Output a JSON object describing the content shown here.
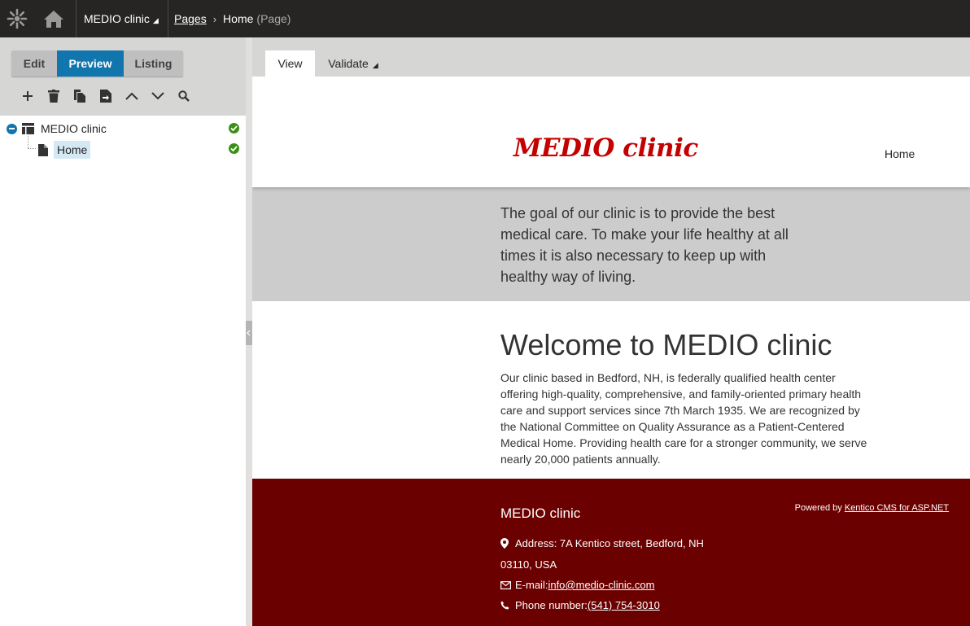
{
  "topbar": {
    "site_name": "MEDIO clinic",
    "breadcrumb_root": "Pages",
    "breadcrumb_current": "Home",
    "breadcrumb_type": "(Page)"
  },
  "modes": {
    "edit": "Edit",
    "preview": "Preview",
    "listing": "Listing",
    "active": "Preview"
  },
  "toolbar_icons": [
    "plus-icon",
    "trash-icon",
    "copy-icon",
    "move-icon",
    "chevron-up-icon",
    "chevron-down-icon",
    "search-icon"
  ],
  "tree": {
    "root_label": "MEDIO clinic",
    "child_label": "Home"
  },
  "view_tabs": {
    "view": "View",
    "validate": "Validate"
  },
  "preview": {
    "logo": "MEDIO clinic",
    "nav_home": "Home",
    "hero_text": "The goal of our clinic is to provide the best medical care. To make your life healthy at all times it is also necessary to keep up with healthy way of living.",
    "welcome_title": "Welcome to MEDIO clinic",
    "welcome_text": "Our clinic based in Bedford, NH, is federally qualified health center offering high-quality, comprehensive, and family-oriented primary health care and support services since 7th March 1935. We are recognized by the National Committee on Quality Assurance as a Patient-Centered Medical Home. Providing health care for a stronger community, we serve nearly 20,000 patients annually.",
    "footer": {
      "title": "MEDIO clinic",
      "powered_prefix": "Powered by ",
      "powered_link": "Kentico CMS for ASP.NET",
      "address_line1": "Address: 7A Kentico street, Bedford, NH",
      "address_line2": "03110, USA",
      "email_label": "E-mail: ",
      "email": "info@medio-clinic.com",
      "phone_label": "Phone number: ",
      "phone": "(541) 754-3010"
    }
  },
  "colors": {
    "topbar": "#262524",
    "accent": "#1175ae",
    "logo_red": "#c50000",
    "footer": "#6b0000",
    "hero_gray": "#cccccc",
    "status_green": "#3a8f17"
  }
}
